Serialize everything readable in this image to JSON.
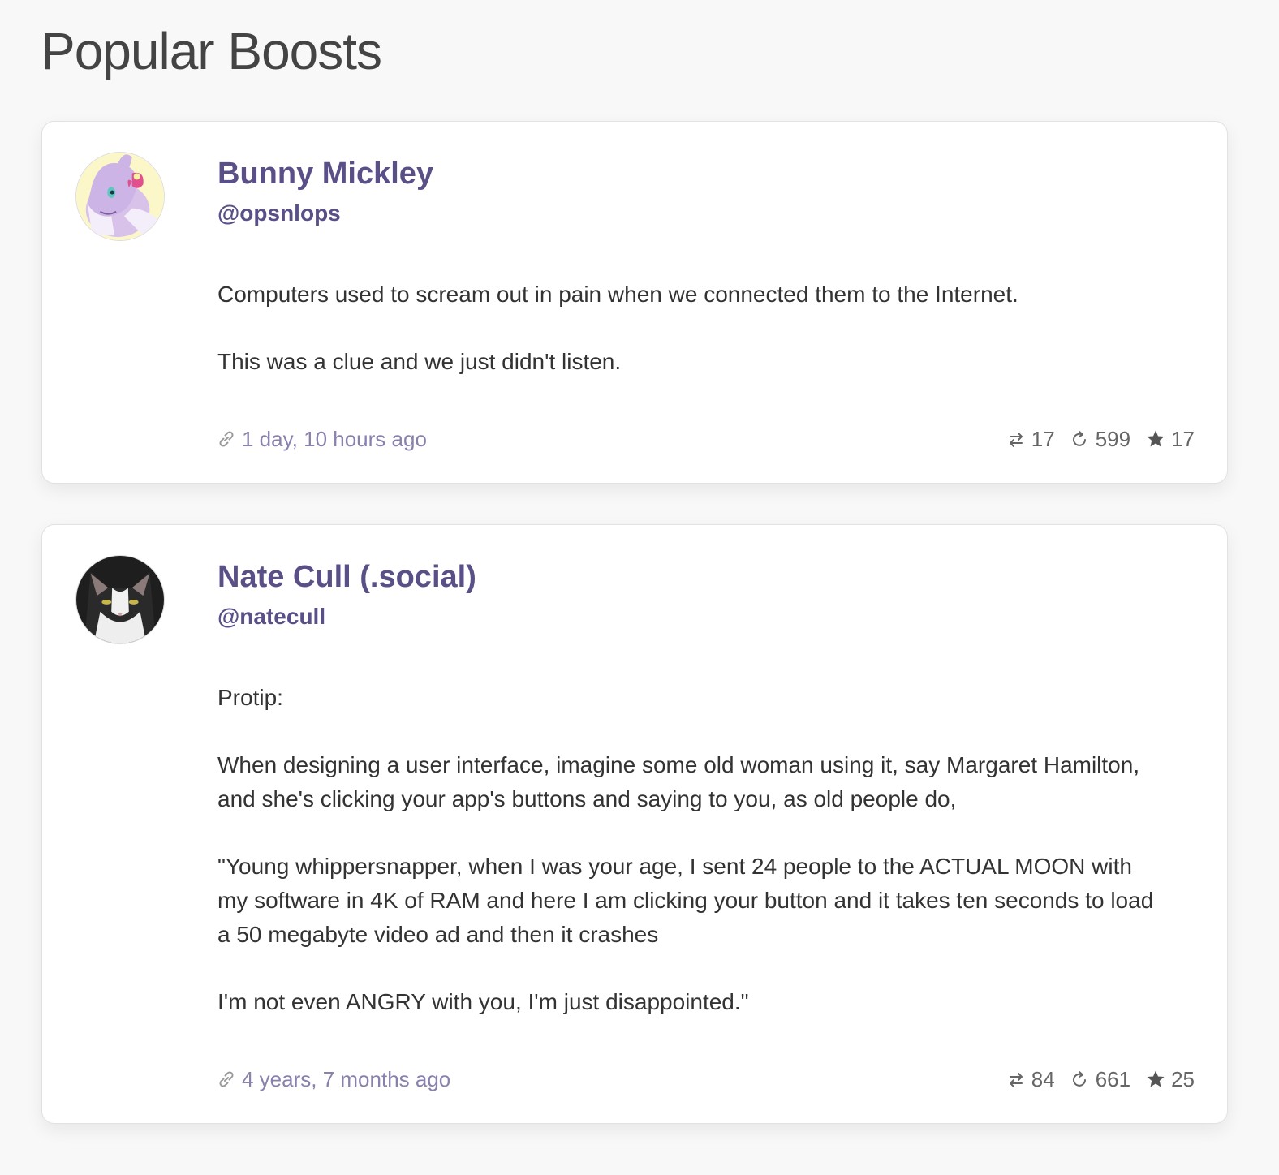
{
  "page": {
    "title": "Popular Boosts"
  },
  "posts": [
    {
      "author_name": "Bunny Mickley",
      "handle": "@opsnlops",
      "paragraphs": [
        "Computers used to scream out in pain when we connected them to the Internet.",
        "This was a clue and we just didn't listen."
      ],
      "timestamp": "1 day, 10 hours ago",
      "replies": "17",
      "boosts": "599",
      "favourites": "17",
      "icons": [
        "link-icon",
        "reply-icon",
        "boost-icon",
        "star-icon"
      ]
    },
    {
      "author_name": "Nate Cull (.social)",
      "handle": "@natecull",
      "paragraphs": [
        "Protip:",
        "When designing a user interface, imagine some old woman using it, say Margaret Hamilton, and she's clicking your app's buttons and saying to you, as old people do,",
        "\"Young whippersnapper, when I was your age, I sent 24 people to the ACTUAL MOON with my software in 4K of RAM and here I am clicking your button and it takes ten seconds to load a 50 megabyte video ad and then it crashes",
        "I'm not even ANGRY with you, I'm just disappointed.\""
      ],
      "timestamp": "4 years, 7 months ago",
      "replies": "84",
      "boosts": "661",
      "favourites": "25",
      "icons": [
        "link-icon",
        "reply-icon",
        "boost-icon",
        "star-icon"
      ]
    }
  ],
  "colors": {
    "accent": "#5a4f86",
    "timestamp": "#8a80ad",
    "background": "#f8f8f8",
    "card": "#ffffff"
  }
}
